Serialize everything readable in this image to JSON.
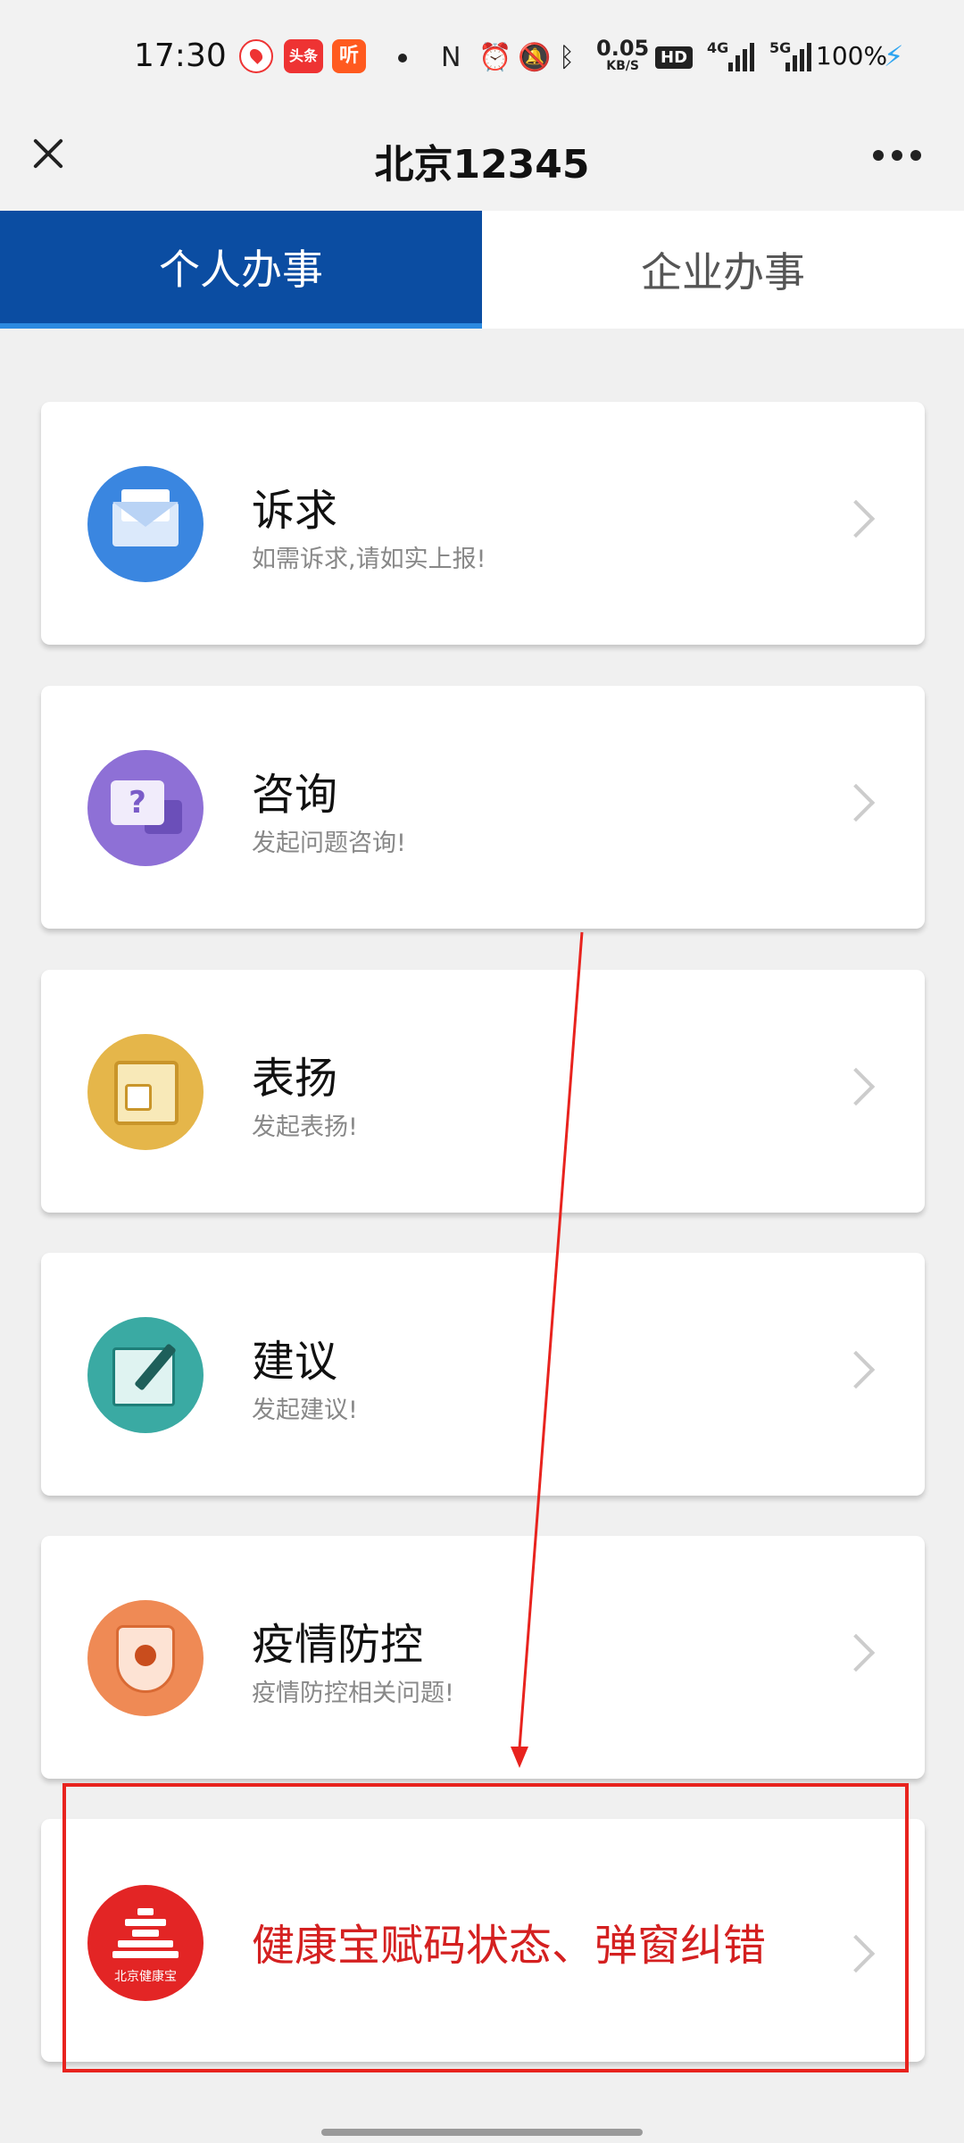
{
  "status_bar": {
    "time": "17:30",
    "notif_toutiao": "头条",
    "notif_ting": "听",
    "net_speed_value": "0.05",
    "net_speed_unit": "KB/S",
    "hd_badge": "HD",
    "sig1_tag": "4G",
    "sig2_tag": "5G",
    "battery": "100%"
  },
  "header": {
    "title": "北京12345"
  },
  "tabs": [
    {
      "label": "个人办事",
      "active": true
    },
    {
      "label": "企业办事",
      "active": false
    }
  ],
  "cards": [
    {
      "title": "诉求",
      "subtitle": "如需诉求,请如实上报!",
      "icon": "envelope-icon"
    },
    {
      "title": "咨询",
      "subtitle": "发起问题咨询!",
      "icon": "question-chat-icon"
    },
    {
      "title": "表扬",
      "subtitle": "发起表扬!",
      "icon": "thumbs-up-icon"
    },
    {
      "title": "建议",
      "subtitle": "发起建议!",
      "icon": "edit-note-icon"
    },
    {
      "title": "疫情防控",
      "subtitle": "疫情防控相关问题!",
      "icon": "virus-shield-icon"
    },
    {
      "title": "健康宝赋码状态、弹窗纠错",
      "icon": "beijing-health-kit-logo",
      "icon_label": "北京健康宝"
    }
  ],
  "colors": {
    "tab_active_bg": "#0b4da2",
    "annotation_red": "#e8231e",
    "highlight_title_red": "#d42020"
  }
}
